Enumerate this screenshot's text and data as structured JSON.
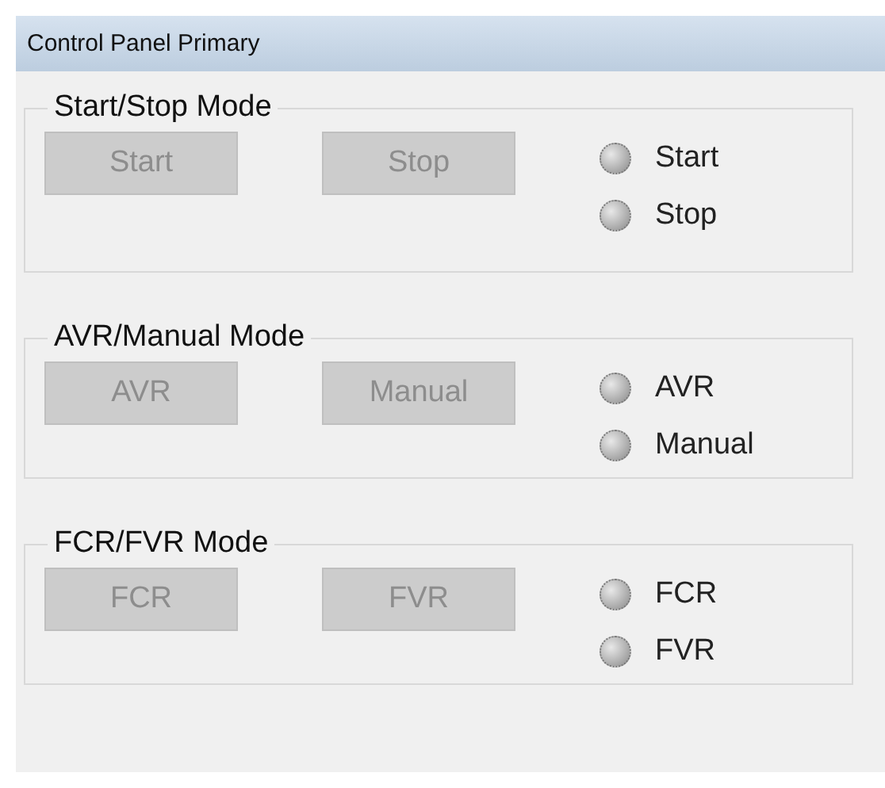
{
  "window": {
    "title": "Control Panel Primary"
  },
  "groups": [
    {
      "title": "Start/Stop Mode",
      "buttons": [
        {
          "label": "Start",
          "disabled": true
        },
        {
          "label": "Stop",
          "disabled": true
        }
      ],
      "indicators": [
        {
          "label": "Start",
          "on": false
        },
        {
          "label": "Stop",
          "on": false
        }
      ]
    },
    {
      "title": "AVR/Manual Mode",
      "buttons": [
        {
          "label": "AVR",
          "disabled": true
        },
        {
          "label": "Manual",
          "disabled": true
        }
      ],
      "indicators": [
        {
          "label": "AVR",
          "on": false
        },
        {
          "label": "Manual",
          "on": false
        }
      ]
    },
    {
      "title": "FCR/FVR Mode",
      "buttons": [
        {
          "label": "FCR",
          "disabled": true
        },
        {
          "label": "FVR",
          "disabled": true
        }
      ],
      "indicators": [
        {
          "label": "FCR",
          "on": false
        },
        {
          "label": "FVR",
          "on": false
        }
      ]
    }
  ]
}
